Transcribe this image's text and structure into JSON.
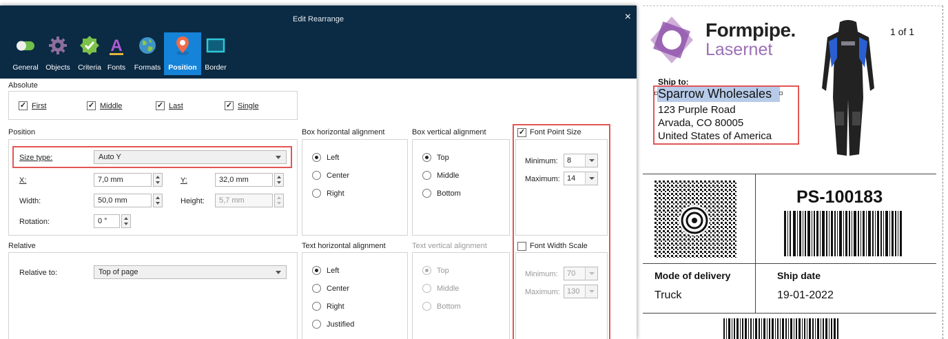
{
  "dialog": {
    "title": "Edit Rearrange",
    "close_label": "×",
    "tabs": [
      {
        "label": "General",
        "icon": "toggle-icon"
      },
      {
        "label": "Objects",
        "icon": "gear-icon"
      },
      {
        "label": "Criteria",
        "icon": "badge-check-icon"
      },
      {
        "label": "Fonts",
        "icon": "font-a-icon"
      },
      {
        "label": "Formats",
        "icon": "globe-icon"
      },
      {
        "label": "Position",
        "icon": "map-pin-icon"
      },
      {
        "label": "Border",
        "icon": "border-icon"
      }
    ],
    "absolute": {
      "heading": "Absolute",
      "checks": [
        {
          "label": "First",
          "checked": true
        },
        {
          "label": "Middle",
          "checked": true
        },
        {
          "label": "Last",
          "checked": true
        },
        {
          "label": "Single",
          "checked": true
        }
      ]
    },
    "position": {
      "heading": "Position",
      "size_type_label": "Size type:",
      "size_type_value": "Auto Y",
      "x_label": "X:",
      "x_value": "7,0 mm",
      "y_label": "Y:",
      "y_value": "32,0 mm",
      "width_label": "Width:",
      "width_value": "50,0 mm",
      "height_label": "Height:",
      "height_value": "5,7 mm",
      "rotation_label": "Rotation:",
      "rotation_value": "0 °"
    },
    "box_h_align": {
      "heading": "Box horizontal alignment",
      "options": [
        "Left",
        "Center",
        "Right"
      ],
      "selected": "Left"
    },
    "box_v_align": {
      "heading": "Box vertical alignment",
      "options": [
        "Top",
        "Middle",
        "Bottom"
      ],
      "selected": "Top"
    },
    "font_point_size": {
      "label": "Font Point Size",
      "checked": true,
      "min_label": "Minimum:",
      "min_value": "8",
      "max_label": "Maximum:",
      "max_value": "14"
    },
    "relative": {
      "heading": "Relative",
      "label": "Relative to:",
      "value": "Top of page"
    },
    "text_h_align": {
      "heading": "Text horizontal alignment",
      "options": [
        "Left",
        "Center",
        "Right",
        "Justified"
      ],
      "selected": "Left"
    },
    "text_v_align": {
      "heading": "Text vertical alignment",
      "options": [
        "Top",
        "Middle",
        "Bottom"
      ],
      "selected": "Top"
    },
    "font_width_scale": {
      "label": "Font Width Scale",
      "checked": false,
      "min_label": "Minimum:",
      "min_value": "70",
      "max_label": "Maximum:",
      "max_value": "130"
    }
  },
  "label": {
    "brand_line1": "Formpipe.",
    "brand_line2": "Lasernet",
    "page": "1 of 1",
    "ship_to_heading": "Ship to:",
    "ship_to_name": "Sparrow Wholesales",
    "address_line1": "123 Purple Road",
    "address_line2": "Arvada, CO 80005",
    "address_line3": "United States of America",
    "package_id": "PS-100183",
    "mode_heading": "Mode of delivery",
    "mode_value": "Truck",
    "date_heading": "Ship date",
    "date_value": "19-01-2022"
  },
  "colors": {
    "titlebar": "#0b2a44",
    "active_tab": "#1583d8",
    "highlight": "#e25555",
    "brand_purple": "#8a4aa8"
  }
}
